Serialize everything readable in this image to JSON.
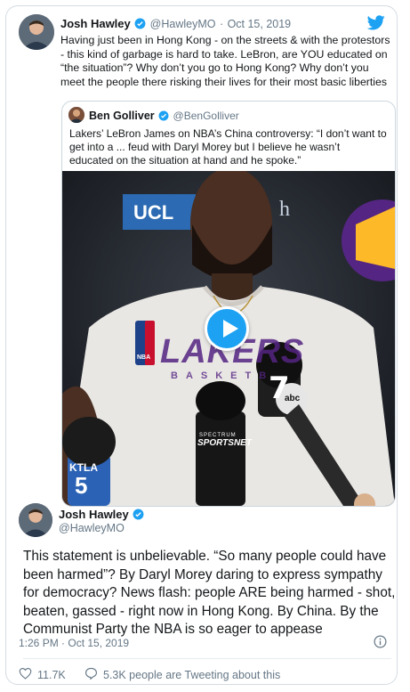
{
  "tweet": {
    "author_name": "Josh Hawley",
    "author_handle": "@HawleyMO",
    "date": "Oct 15, 2019",
    "separator": "·",
    "text_lines": [
      "Having just been in Hong Kong - on the streets & with the protestors",
      "- this kind of garbage is hard to take. LeBron, are YOU educated on",
      "“the situation”? Why don’t you go to Hong Kong? Why don’t you",
      "meet the people there risking their lives for their most basic liberties"
    ]
  },
  "quoted_tweet": {
    "author_name": "Ben Golliver",
    "author_handle": "@BenGolliver",
    "text_lines": [
      "Lakers’ LeBron James on NBA’s China controversy: “I don’t want to",
      "get into a ... feud with Daryl Morey but I believe he wasn’t",
      "educated on the situation at hand and he spoke.”"
    ],
    "video": {
      "backdrop_text": "UCL",
      "backdrop_suffix": "h",
      "shirt_logo": "LAKERS",
      "shirt_sub": "BASKETB",
      "mic_left": "KTLA",
      "mic_left_num": "5",
      "mic_right_num": "7",
      "mic_right_sub": "abc",
      "sponsor_top": "SPECTRUM",
      "sponsor_bottom": "SPORTSNET",
      "nba_badge": "NBA"
    }
  },
  "expanded_tweet": {
    "author_name": "Josh Hawley",
    "author_handle": "@HawleyMO",
    "text_lines": [
      "This statement is unbelievable. “So many people could have",
      "been harmed”? By Daryl Morey daring to express sympathy",
      "for democracy? News flash: people ARE being harmed - shot,",
      "beaten, gassed - right now in Hong Kong. By China. By the",
      "Communist Party the NBA is so eager to appease"
    ],
    "timestamp": "1:26 PM · Oct 15, 2019",
    "likes": "11.7K",
    "conversation": "5.3K people are Tweeting about this"
  },
  "colors": {
    "twitter_blue": "#1da1f2",
    "secondary_text": "#657786",
    "border": "#ccd6dd",
    "lakers_purple": "#552583",
    "lakers_gold": "#fdb927"
  },
  "icons": [
    "twitter-bird-icon",
    "verified-badge-icon",
    "play-icon",
    "info-icon",
    "heart-icon",
    "speech-bubble-icon"
  ]
}
